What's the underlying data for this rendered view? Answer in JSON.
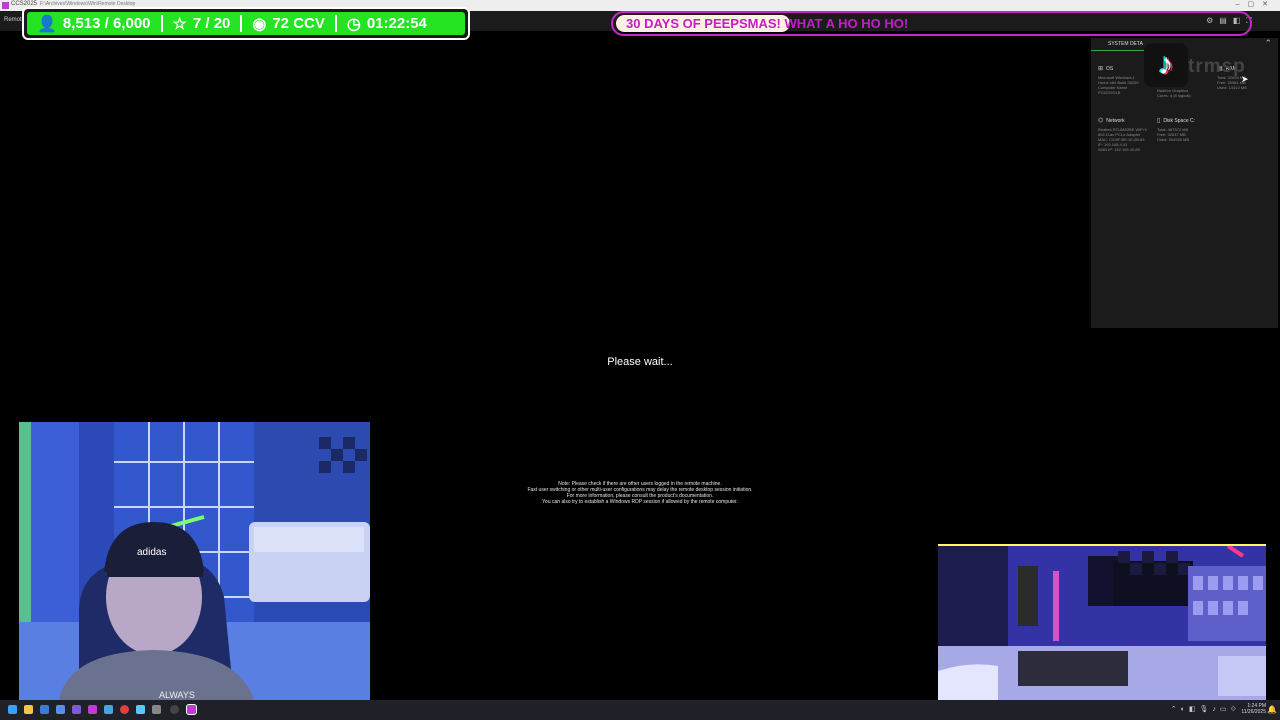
{
  "window": {
    "app_title": "CCS2025",
    "path": "F:\\Archives\\Windows\\Win\\Remote Desktop",
    "toolbar_label": "Remote D"
  },
  "stats_overlay": {
    "followers": "8,513 / 6,000",
    "subs": "7 / 20",
    "ccv": "72 CCV",
    "timer": "01:22:54",
    "accent_color": "#23e323"
  },
  "banner": {
    "text": "30 DAYS OF PEEPSMAS! WHAT A HO HO HO!",
    "color": "#c31dc9"
  },
  "system_panel": {
    "header": "SYSTEM DETA",
    "os": {
      "title": "OS",
      "lines": [
        "Microsoft Windows 1",
        "Home x64 Build 26200",
        "Computer Name",
        "PC6229GLB"
      ]
    },
    "cpu": {
      "lines": [
        "...26 with",
        "Radeon Graphics",
        "Cores: 4 (8 logical)"
      ]
    },
    "ram": {
      "title": "RAM",
      "lines": [
        "Total: 32694 MB",
        "Free: 25981 MB",
        "Used: 13413 MB"
      ]
    },
    "network": {
      "title": "Network",
      "lines": [
        "Realtek RTL8852BE WiFi 6",
        "802.11ax PCI-e Adapter",
        "MAC: C0:BF:BE:1E:2B:63",
        "IP: 192.168.4.41",
        "WAN IP: 162.155.40.85"
      ]
    },
    "disk": {
      "title": "Disk Space C:",
      "lines": [
        "Total: 487372 MB",
        "Free: 92637 MB",
        "Used: 394935 MB"
      ]
    }
  },
  "tiktok": {
    "icon": "tiktok-logo",
    "handle": "trmsp"
  },
  "remote_session": {
    "status": "Please wait...",
    "note_lines": [
      "Note: Please check if there are other users logged in the remote machine.",
      "Fast user switching or other multi-user configurations may delay the remote desktop session initiation.",
      "For more information, please consult the product's documentation.",
      "You can also try to establish a Windows RDP session if allowed by the remote computer."
    ]
  },
  "webcam_main": {
    "shirt_text": "ALWAYS",
    "cap_text": "adidas"
  },
  "taskbar": {
    "time": "1:24 PM",
    "date": "11/26/2025"
  }
}
